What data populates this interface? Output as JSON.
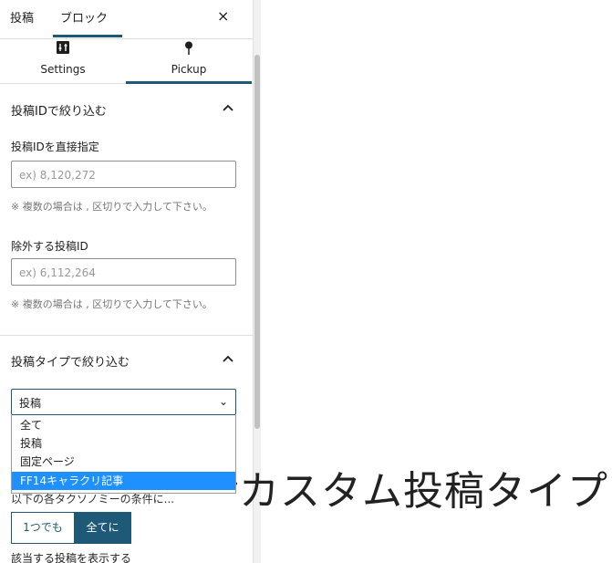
{
  "top_tabs": {
    "post_label": "投稿",
    "block_label": "ブロック",
    "close_label": "×"
  },
  "sub_tabs": [
    {
      "label": "Settings",
      "icon": "sliders-icon"
    },
    {
      "label": "Pickup",
      "icon": "pin-icon"
    }
  ],
  "section_post_id": {
    "title": "投稿IDで絞り込む",
    "direct": {
      "label": "投稿IDを直接指定",
      "placeholder": "ex) 8,120,272",
      "help": "※ 複数の場合は , 区切りで入力して下さい。"
    },
    "exclude": {
      "label": "除外する投稿ID",
      "placeholder": "ex) 6,112,264",
      "help": "※ 複数の場合は , 区切りで入力して下さい。"
    }
  },
  "section_post_type": {
    "title": "投稿タイプで絞り込む",
    "selected": "投稿",
    "caret": "⌄",
    "options": [
      "全て",
      "投稿",
      "固定ページ",
      "FF14キャラクリ記事"
    ],
    "highlighted_index": 3
  },
  "taxonomy": {
    "text": "以下の各タクソノミーの条件に...",
    "any_label": "1つでも",
    "all_label": "全てに"
  },
  "bottom_label": "該当する投稿を表示する",
  "annotation": {
    "text": "カスタム投稿タイプ"
  },
  "colors": {
    "accent": "#1e5a78",
    "highlight": "#1e90ff"
  }
}
